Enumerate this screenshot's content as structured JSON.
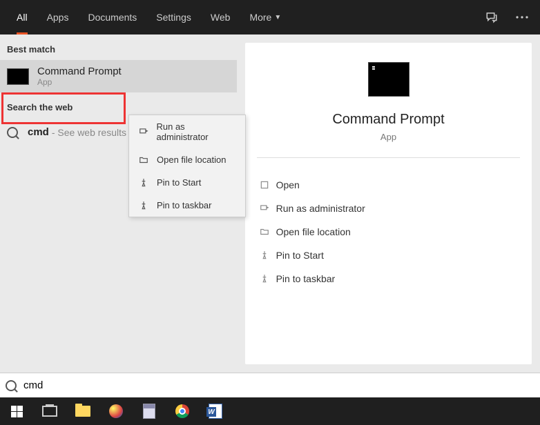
{
  "tabs": {
    "all": "All",
    "apps": "Apps",
    "documents": "Documents",
    "settings": "Settings",
    "web": "Web",
    "more": "More"
  },
  "sections": {
    "best_match": "Best match",
    "search_web": "Search the web"
  },
  "result": {
    "title": "Command Prompt",
    "subtitle": "App"
  },
  "web": {
    "query": "cmd",
    "hint": "- See web results"
  },
  "context_menu": {
    "run_admin": "Run as administrator",
    "open_location": "Open file location",
    "pin_start": "Pin to Start",
    "pin_taskbar": "Pin to taskbar"
  },
  "details": {
    "name": "Command Prompt",
    "type": "App",
    "actions": {
      "open": "Open",
      "run_admin": "Run as administrator",
      "open_location": "Open file location",
      "pin_start": "Pin to Start",
      "pin_taskbar": "Pin to taskbar"
    }
  },
  "search": {
    "value": "cmd"
  }
}
